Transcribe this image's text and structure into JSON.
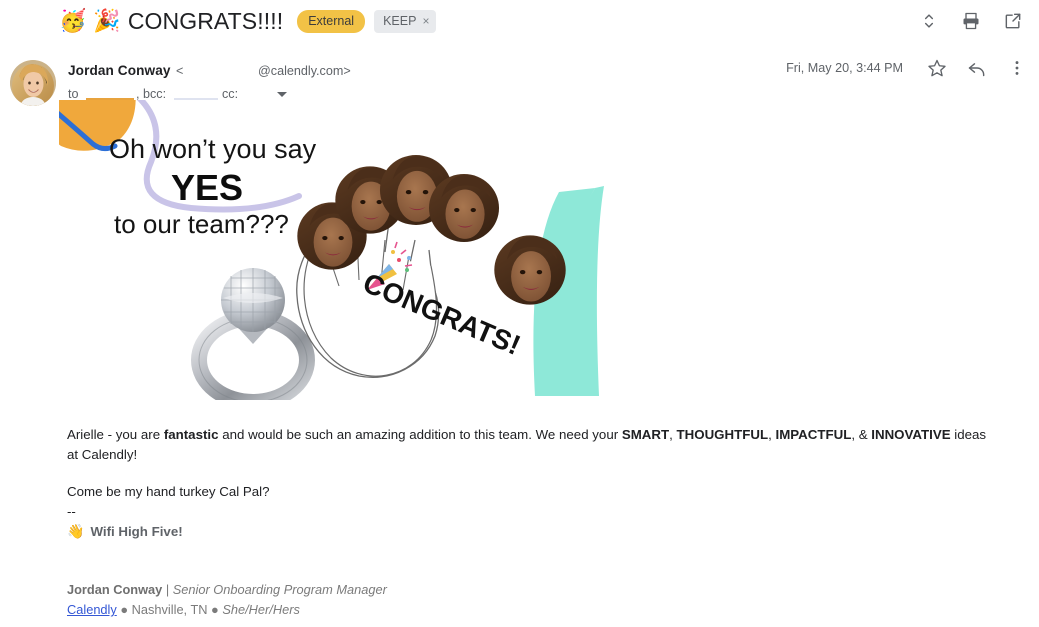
{
  "toolbar": {
    "emoji_party_face": "🥳",
    "emoji_party_popper": "🎉",
    "subject": "CONGRATS!!!!",
    "external_badge": "External",
    "label_chip": "KEEP",
    "label_chip_remove": "×",
    "icons": {
      "expand": "expand-collapse-icon",
      "print": "print-icon",
      "popout": "open-in-new-window-icon"
    }
  },
  "message_header": {
    "sender_name": "Jordan Conway",
    "angle_open": "<",
    "email_domain": "@calendly.com>",
    "to_label": "to",
    "bcc_label": ", bcc:",
    "cc_label": "cc:",
    "date": "Fri, May 20, 3:44 PM",
    "icons": {
      "star": "star-icon",
      "reply": "reply-icon",
      "more": "more-vert-icon",
      "details": "chevron-down-icon",
      "avatar": "avatar"
    }
  },
  "meme": {
    "line1": "Oh won’t you say",
    "line2": "YES",
    "line3": "to our team???",
    "hand_text": "CONGRATS!",
    "popper_emoji": "🎉",
    "colors": {
      "orange_blob": "#f0a83c",
      "blue_squiggle": "#2c6fd6",
      "purple_wave": "#c9c4e8",
      "teal_stripe": "#8ee8d8",
      "hand_outline": "#6b6b6b",
      "text": "#1b1b1b"
    }
  },
  "body": {
    "p1_a": "Arielle - you are ",
    "p1_b": "fantastic",
    "p1_c": " and would be such an amazing addition to this team. We need your ",
    "p1_d": "SMART",
    "p1_e": ", ",
    "p1_f": "THOUGHTFUL",
    "p1_g": ", ",
    "p1_h": "IMPACTFUL",
    "p1_i": ", & ",
    "p1_j": "INNOVATIVE",
    "p1_k": " ideas at Calendly!",
    "p2": "Come be my hand turkey Cal Pal?",
    "dashes": "--",
    "wifi_emoji": "👋",
    "wifi_text": "Wifi High Five!"
  },
  "signature": {
    "name": "Jordan Conway",
    "pipe": " | ",
    "title": "Senior Onboarding Program Manager",
    "company_link": "Calendly",
    "sep1": " ● ",
    "location": "Nashville, TN",
    "sep2": " ● ",
    "pronouns": "She/Her/Hers"
  }
}
